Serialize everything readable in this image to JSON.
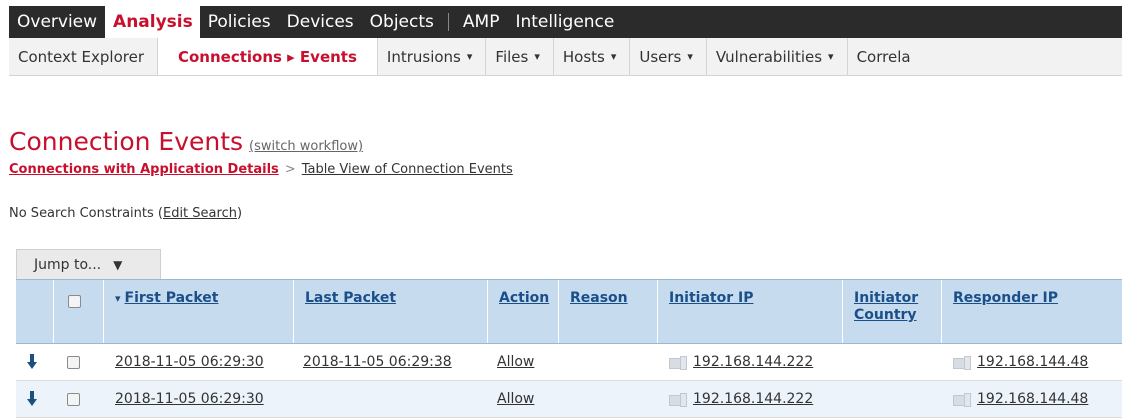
{
  "topnav": {
    "tabs": [
      "Overview",
      "Analysis",
      "Policies",
      "Devices",
      "Objects",
      "AMP",
      "Intelligence"
    ],
    "active_tab": "Analysis"
  },
  "subnav": {
    "items": [
      {
        "label": "Context Explorer",
        "dropdown": false
      },
      {
        "label": "Connections ▸ Events",
        "dropdown": false
      },
      {
        "label": "Intrusions",
        "dropdown": true
      },
      {
        "label": "Files",
        "dropdown": true
      },
      {
        "label": "Hosts",
        "dropdown": true
      },
      {
        "label": "Users",
        "dropdown": true
      },
      {
        "label": "Vulnerabilities",
        "dropdown": true
      },
      {
        "label": "Correla",
        "dropdown": false
      }
    ],
    "caret": "▾"
  },
  "page": {
    "title": "Connection Events",
    "switch_workflow": "(switch workflow)"
  },
  "breadcrumb": {
    "first": "Connections with Application Details",
    "separator": ">",
    "second": "Table View of Connection Events"
  },
  "search": {
    "prefix": "No Search Constraints (",
    "link": "Edit Search",
    "suffix": ")"
  },
  "jump_to": {
    "label": "Jump to...",
    "caret": "▼"
  },
  "table": {
    "sort_indicator": "▾",
    "columns": {
      "first_packet": "First Packet",
      "last_packet": "Last Packet",
      "action": "Action",
      "reason": "Reason",
      "initiator_ip": "Initiator IP",
      "initiator_country": "Initiator Country",
      "responder_ip": "Responder IP"
    },
    "rows": [
      {
        "first_packet": "2018-11-05 06:29:30",
        "last_packet": "2018-11-05 06:29:38",
        "action": "Allow",
        "reason": "",
        "initiator_ip": "192.168.144.222",
        "initiator_country": "",
        "responder_ip": "192.168.144.48"
      },
      {
        "first_packet": "2018-11-05 06:29:30",
        "last_packet": "",
        "action": "Allow",
        "reason": "",
        "initiator_ip": "192.168.144.222",
        "initiator_country": "",
        "responder_ip": "192.168.144.48"
      }
    ]
  },
  "colors": {
    "accent_red": "#c8102e",
    "header_blue": "#c7dbef",
    "link_blue": "#1a4f8a",
    "nav_dark": "#2b2b2b"
  }
}
